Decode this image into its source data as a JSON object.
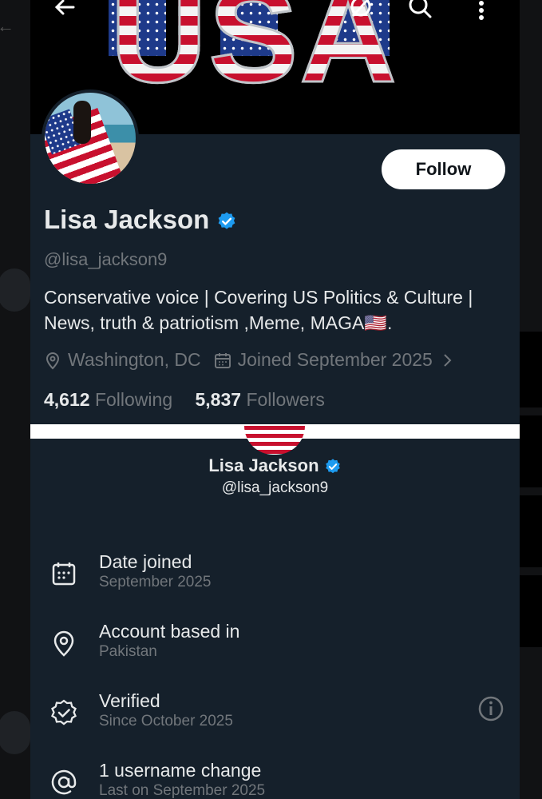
{
  "profile": {
    "banner_text": "USA",
    "name": "Lisa Jackson",
    "handle": "@lisa_jackson9",
    "follow_label": "Follow",
    "bio": "Conservative voice | Covering US Politics & Culture | News, truth & patriotism ,Meme, MAGA🇺🇸.",
    "location": "Washington, DC",
    "joined": "Joined September 2025",
    "following_count": "4,612",
    "following_label": "Following",
    "followers_count": "5,837",
    "followers_label": "Followers"
  },
  "about": {
    "name": "Lisa Jackson",
    "handle": "@lisa_jackson9",
    "rows": [
      {
        "title": "Date joined",
        "sub": "September 2025",
        "icon": "calendar-icon"
      },
      {
        "title": "Account based in",
        "sub": "Pakistan",
        "icon": "location-pin-icon"
      },
      {
        "title": "Verified",
        "sub": "Since October 2025",
        "icon": "verified-badge-icon"
      },
      {
        "title": "1 username change",
        "sub": "Last on September 2025",
        "icon": "at-sign-icon"
      }
    ]
  },
  "colors": {
    "background": "#15202b",
    "verified": "#1d9bf0",
    "muted": "#71767b",
    "text": "#e7e9ea"
  }
}
